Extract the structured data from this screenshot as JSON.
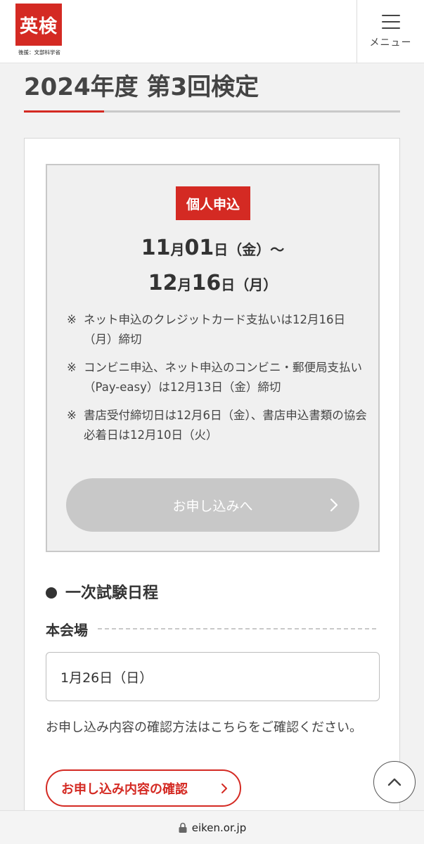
{
  "header": {
    "logo_text": "英検",
    "logo_sub": "後援：文部科学省",
    "menu_label": "メニュー"
  },
  "page": {
    "title": "2024年度 第3回検定"
  },
  "application": {
    "badge": "個人申込",
    "start_month": "11",
    "start_month_unit": "月",
    "start_day": "01",
    "start_day_unit": "日",
    "start_weekday": "（金）～",
    "end_month": "12",
    "end_month_unit": "月",
    "end_day": "16",
    "end_day_unit": "日",
    "end_weekday": "（月）",
    "notes": [
      {
        "mark": "※",
        "text": "ネット申込のクレジットカード支払いは12月16日（月）締切"
      },
      {
        "mark": "※",
        "text": "コンビニ申込、ネット申込のコンビニ・郵便局支払い（Pay-easy）は12月13日（金）締切"
      },
      {
        "mark": "※",
        "text": "書店受付締切日は12月6日（金）、書店申込書類の協会必着日は12月10日（火）"
      }
    ],
    "apply_button": "お申し込みへ"
  },
  "schedule": {
    "heading": "一次試験日程",
    "venue_label": "本会場",
    "venue_date": "1月26日（日）",
    "confirm_text": "お申し込み内容の確認方法はこちらをご確認ください。",
    "confirm_button": "お申し込み内容の確認"
  },
  "browser": {
    "url": "eiken.or.jp"
  },
  "colors": {
    "brand_red": "#d42a23",
    "disabled_gray": "#c8c8c8"
  },
  "icons": {
    "menu": "hamburger-icon",
    "apply_chevron": "chevron-right-icon",
    "confirm_chevron": "chevron-right-icon",
    "scroll_top": "chevron-up-icon",
    "lock": "lock-icon"
  }
}
